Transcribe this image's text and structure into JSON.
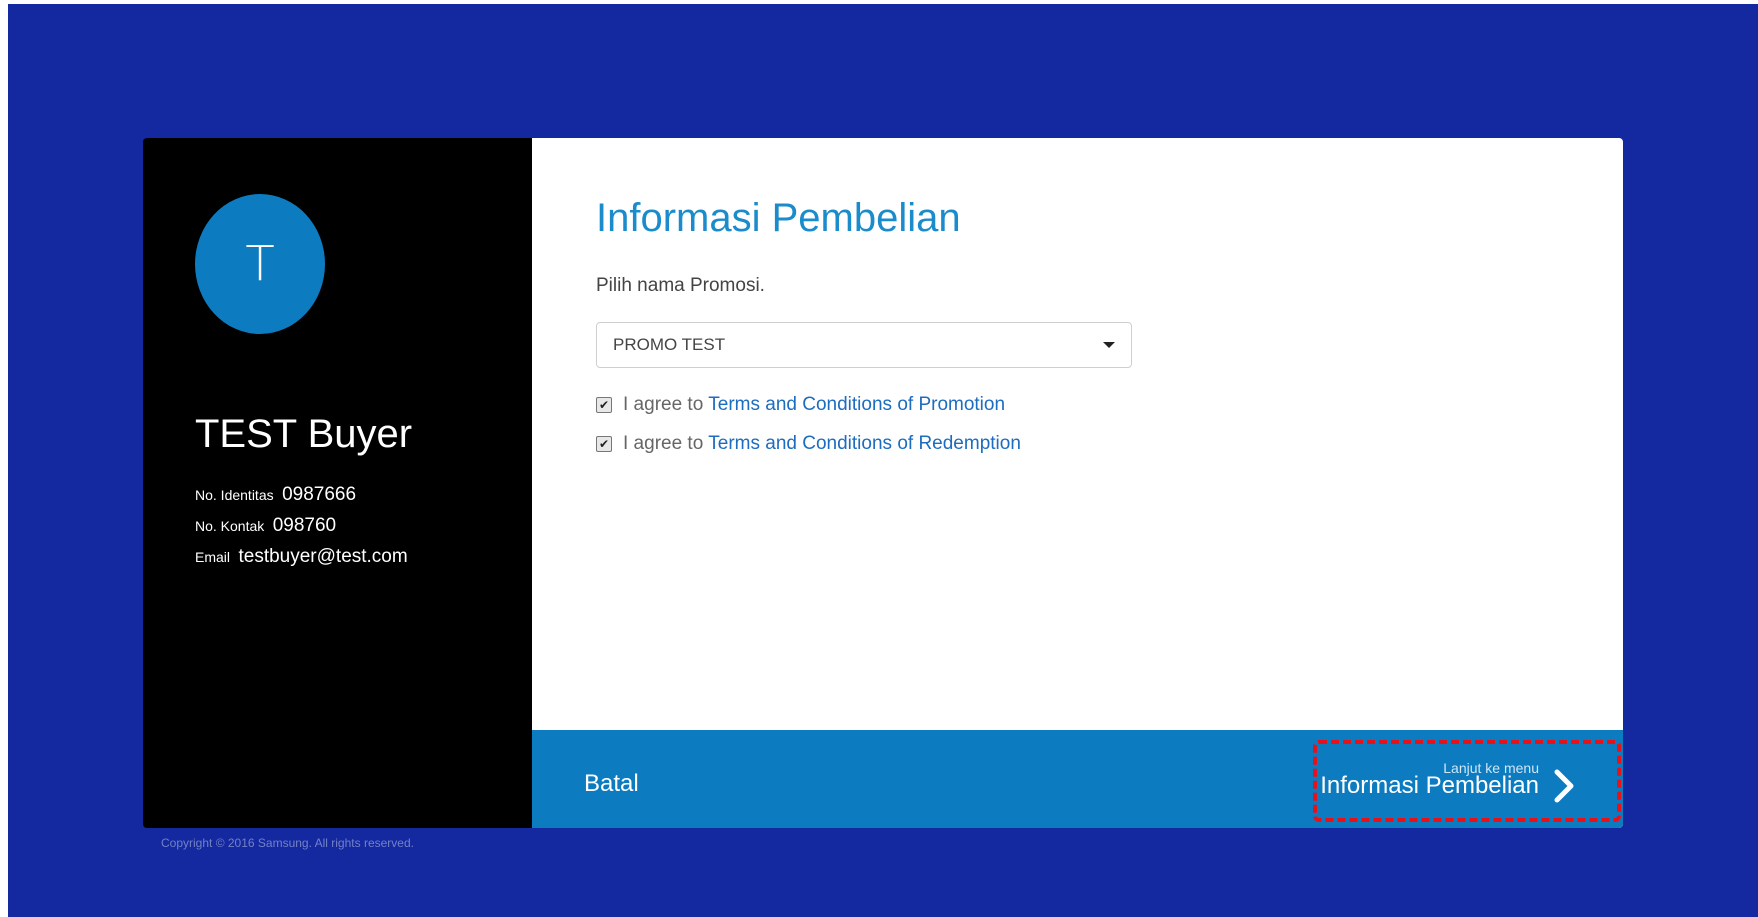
{
  "profile": {
    "avatar_initial": "T",
    "name": "TEST Buyer",
    "fields": [
      {
        "label": "No. Identitas",
        "value": "0987666"
      },
      {
        "label": "No. Kontak",
        "value": "098760"
      },
      {
        "label": "Email",
        "value": "testbuyer@test.com"
      }
    ]
  },
  "main": {
    "title": "Informasi Pembelian",
    "promo_label": "Pilih nama Promosi.",
    "promo_selected": "PROMO TEST",
    "agreements": [
      {
        "prefix": "I agree to",
        "link": "Terms and Conditions of Promotion",
        "checked": true
      },
      {
        "prefix": "I agree to",
        "link": "Terms and Conditions of Redemption",
        "checked": true
      }
    ]
  },
  "footer": {
    "cancel_label": "Batal",
    "next_small": "Lanjut ke menu",
    "next_label": "Informasi Pembelian"
  },
  "copyright": "Copyright © 2016 Samsung. All rights reserved.",
  "colors": {
    "background": "#1428a0",
    "accent": "#0c7bc0",
    "title": "#1a8ccc",
    "link": "#1c6cbf",
    "highlight": "#e8111a"
  },
  "icons": [
    "chevron-right-icon",
    "caret-down-icon",
    "checkbox-checked-icon"
  ]
}
